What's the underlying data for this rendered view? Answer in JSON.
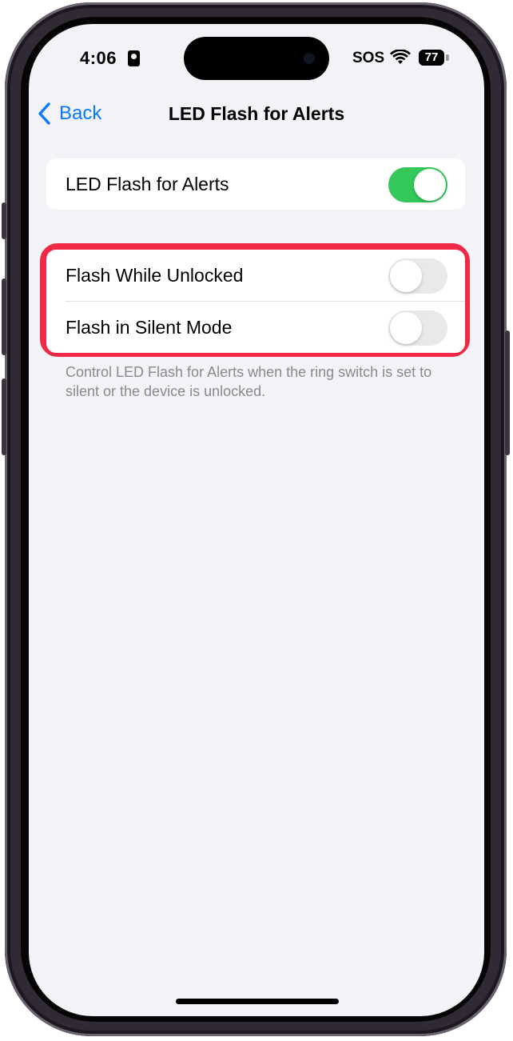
{
  "status_bar": {
    "time": "4:06",
    "carrier": "SOS",
    "battery": "77"
  },
  "nav": {
    "back_label": "Back",
    "title": "LED Flash for Alerts"
  },
  "settings": {
    "main": {
      "label": "LED Flash for Alerts",
      "enabled": true
    },
    "options": [
      {
        "label": "Flash While Unlocked",
        "enabled": false
      },
      {
        "label": "Flash in Silent Mode",
        "enabled": false
      }
    ],
    "footer_note": "Control LED Flash for Alerts when the ring switch is set to silent or the device is unlocked."
  },
  "colors": {
    "accent": "#0a7aff",
    "toggle_on": "#34c759",
    "toggle_off": "#e9e9eb",
    "highlight": "#f02a46",
    "background": "#f2f2f7"
  }
}
